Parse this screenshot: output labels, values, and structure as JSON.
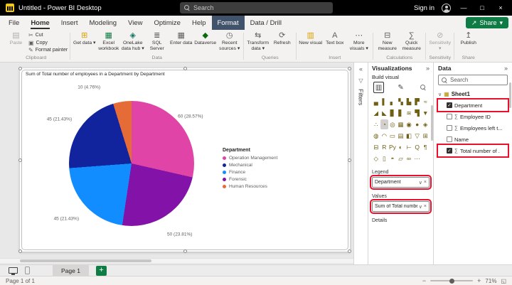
{
  "colors": {
    "titlebar_bg": "#000000",
    "accent_yellow": "#f2c811",
    "share_green": "#0f7b45",
    "contextual_tab_bg": "#41536b",
    "highlight_red": "#e8112d"
  },
  "glyphs": {
    "caret": "▾",
    "chevron_right": "»",
    "chevron_left": "«",
    "chevron_down": "∨",
    "close": "×",
    "funnel": "▽",
    "plus": "+",
    "minus": "−",
    "share": "↗",
    "build": "▥",
    "format": "✎",
    "table": "▦",
    "fit": "◱",
    "check": "✓",
    "win_min": "—",
    "win_max": "□",
    "win_close": "×"
  },
  "titlebar": {
    "app_title": "Untitled - Power BI Desktop",
    "search_placeholder": "Search",
    "sign_in": "Sign in"
  },
  "tabs": {
    "share_label": "Share",
    "items": [
      {
        "label": "File"
      },
      {
        "label": "Home",
        "active": true
      },
      {
        "label": "Insert"
      },
      {
        "label": "Modeling"
      },
      {
        "label": "View"
      },
      {
        "label": "Optimize"
      },
      {
        "label": "Help"
      },
      {
        "label": "Format",
        "contextual": true
      },
      {
        "label": "Data / Drill"
      }
    ]
  },
  "ribbon": {
    "groups": [
      {
        "name": "Clipboard",
        "buttons": [
          {
            "label": "Paste",
            "glyph": "▤",
            "disabled": true
          },
          {
            "label": "Cut",
            "glyph": "✂",
            "small": true
          },
          {
            "label": "Copy",
            "glyph": "▣",
            "small": true
          },
          {
            "label": "Format painter",
            "glyph": "✎",
            "small": true
          }
        ]
      },
      {
        "name": "Data",
        "buttons": [
          {
            "label": "Get data",
            "glyph": "⊞",
            "color": "#d8a200",
            "caret": true
          },
          {
            "label": "Excel workbook",
            "glyph": "▦",
            "color": "#107c41"
          },
          {
            "label": "OneLake data hub",
            "glyph": "◈",
            "color": "#117865",
            "caret": true
          },
          {
            "label": "SQL Server",
            "glyph": "≣",
            "color": "#605e5c"
          },
          {
            "label": "Enter data",
            "glyph": "▦",
            "color": "#605e5c"
          },
          {
            "label": "Dataverse",
            "glyph": "◆",
            "color": "#0b6a0b"
          },
          {
            "label": "Recent sources",
            "glyph": "◷",
            "color": "#605e5c",
            "caret": true
          }
        ]
      },
      {
        "name": "Queries",
        "buttons": [
          {
            "label": "Transform data",
            "glyph": "⇆",
            "color": "#605e5c",
            "caret": true
          },
          {
            "label": "Refresh",
            "glyph": "⟳",
            "color": "#605e5c"
          }
        ]
      },
      {
        "name": "Insert",
        "buttons": [
          {
            "label": "New visual",
            "glyph": "▥",
            "color": "#d8a200"
          },
          {
            "label": "Text box",
            "glyph": "A",
            "color": "#605e5c"
          },
          {
            "label": "More visuals",
            "glyph": "⋯",
            "color": "#605e5c",
            "caret": true
          }
        ]
      },
      {
        "name": "Calculations",
        "buttons": [
          {
            "label": "New measure",
            "glyph": "⊟",
            "color": "#605e5c"
          },
          {
            "label": "Quick measure",
            "glyph": "∑",
            "color": "#605e5c"
          }
        ]
      },
      {
        "name": "Sensitivity",
        "buttons": [
          {
            "label": "Sensitivity",
            "glyph": "⊘",
            "disabled": true,
            "caret": true
          }
        ]
      },
      {
        "name": "Share",
        "buttons": [
          {
            "label": "Publish",
            "glyph": "↥",
            "color": "#605e5c"
          }
        ]
      }
    ]
  },
  "chart_data": {
    "type": "pie",
    "title": "Sum of Total number of employees in a Department by Department",
    "legend_title": "Department",
    "slices": [
      {
        "label": "Operation Management",
        "value": 60,
        "pct": "28.57%",
        "color": "#e044a7"
      },
      {
        "label": "Forensic",
        "value": 50,
        "pct": "23.81%",
        "color": "#8312a8",
        "label_dx": 8,
        "label_dy": 12
      },
      {
        "label": "Finance",
        "value": 45,
        "pct": "21.43%",
        "color": "#118dff",
        "label_dx": -14,
        "label_dy": 6
      },
      {
        "label": "Mechanical",
        "value": 45,
        "pct": "21.43%",
        "color": "#12239e",
        "label_dx": -14,
        "label_dy": -2
      },
      {
        "label": "Human Resources",
        "value": 10,
        "pct": "4.76%",
        "color": "#e66c37",
        "label_dx": -44,
        "label_dy": -2
      }
    ],
    "legend_order": [
      0,
      3,
      2,
      1,
      4
    ]
  },
  "filters_panel": {
    "title": "Filters"
  },
  "visualizations": {
    "title": "Visualizations",
    "build_label": "Build visual",
    "legend_label": "Legend",
    "legend_value": "Department",
    "values_label": "Values",
    "values_value": "Sum of Total number ...",
    "details_label": "Details",
    "icons": [
      {
        "name": "stacked-bar-chart",
        "glyph": "▄"
      },
      {
        "name": "stacked-column-chart",
        "glyph": "▌"
      },
      {
        "name": "clustered-bar-chart",
        "glyph": "▖"
      },
      {
        "name": "clustered-column-chart",
        "glyph": "▚"
      },
      {
        "name": "100-stacked-bar-chart",
        "glyph": "▙"
      },
      {
        "name": "100-stacked-column-chart",
        "glyph": "▛"
      },
      {
        "name": "line-chart",
        "glyph": "≈"
      },
      {
        "name": "area-chart",
        "glyph": "◢"
      },
      {
        "name": "stacked-area-chart",
        "glyph": "◣"
      },
      {
        "name": "line-and-stacked-column-chart",
        "glyph": "▊"
      },
      {
        "name": "line-and-clustered-column-chart",
        "glyph": "▋"
      },
      {
        "name": "ribbon-chart",
        "glyph": "≋"
      },
      {
        "name": "waterfall-chart",
        "glyph": "▜"
      },
      {
        "name": "funnel-chart",
        "glyph": "▼"
      },
      {
        "name": "scatter-chart",
        "glyph": "∴"
      },
      {
        "name": "pie-chart",
        "glyph": "◔",
        "selected": true
      },
      {
        "name": "donut-chart",
        "glyph": "◎"
      },
      {
        "name": "treemap",
        "glyph": "▦"
      },
      {
        "name": "map",
        "glyph": "◉"
      },
      {
        "name": "filled-map",
        "glyph": "●"
      },
      {
        "name": "shape-map",
        "glyph": "◈"
      },
      {
        "name": "azure-map",
        "glyph": "◍"
      },
      {
        "name": "gauge",
        "glyph": "◠"
      },
      {
        "name": "card",
        "glyph": "▭"
      },
      {
        "name": "multi-row-card",
        "glyph": "▤"
      },
      {
        "name": "kpi",
        "glyph": "◧"
      },
      {
        "name": "slicer",
        "glyph": "▽"
      },
      {
        "name": "table",
        "glyph": "⊞"
      },
      {
        "name": "matrix",
        "glyph": "⊟"
      },
      {
        "name": "r-script-visual",
        "glyph": "R"
      },
      {
        "name": "python-visual",
        "glyph": "Py"
      },
      {
        "name": "key-influencers",
        "glyph": "◐"
      },
      {
        "name": "decomposition-tree",
        "glyph": "⊢"
      },
      {
        "name": "qa-visual",
        "glyph": "Q"
      },
      {
        "name": "narrative",
        "glyph": "¶"
      },
      {
        "name": "metrics",
        "glyph": "◇"
      },
      {
        "name": "paginated-report",
        "glyph": "▯"
      },
      {
        "name": "arcgis-map",
        "glyph": "◓"
      },
      {
        "name": "power-apps",
        "glyph": "▱"
      },
      {
        "name": "power-automate",
        "glyph": "∞"
      },
      {
        "name": "get-more-visuals",
        "glyph": "⋯"
      }
    ]
  },
  "data_panel": {
    "title": "Data",
    "search_placeholder": "Search",
    "table_name": "Sheet1",
    "fields": [
      {
        "name": "Department",
        "checked": true,
        "highlighted": true
      },
      {
        "name": "Employee ID",
        "sigma": true
      },
      {
        "name": "Employees left t...",
        "sigma": true
      },
      {
        "name": "Name"
      },
      {
        "name": "Total number of .",
        "sigma": true,
        "checked": true,
        "highlighted": true
      }
    ]
  },
  "pagebar": {
    "page_tab": "Page 1"
  },
  "statusbar": {
    "page_info": "Page 1 of 1",
    "zoom": "71%"
  }
}
